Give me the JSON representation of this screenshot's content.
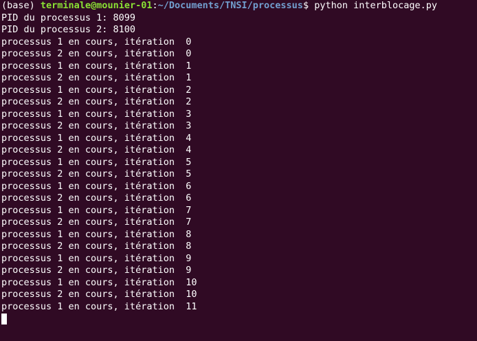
{
  "prompt": {
    "env": "(base) ",
    "user_host": "terminale@mounier-01",
    "separator": ":",
    "path": "~/Documents/TNSI/processus",
    "symbol": "$ ",
    "command": "python interblocage.py"
  },
  "output_lines": [
    "PID du processus 1: 8099",
    "PID du processus 2: 8100",
    "processus 1 en cours, itération  0",
    "processus 2 en cours, itération  0",
    "processus 1 en cours, itération  1",
    "processus 2 en cours, itération  1",
    "processus 1 en cours, itération  2",
    "processus 2 en cours, itération  2",
    "processus 1 en cours, itération  3",
    "processus 2 en cours, itération  3",
    "processus 1 en cours, itération  4",
    "processus 2 en cours, itération  4",
    "processus 1 en cours, itération  5",
    "processus 2 en cours, itération  5",
    "processus 1 en cours, itération  6",
    "processus 2 en cours, itération  6",
    "processus 1 en cours, itération  7",
    "processus 2 en cours, itération  7",
    "processus 1 en cours, itération  8",
    "processus 2 en cours, itération  8",
    "processus 1 en cours, itération  9",
    "processus 2 en cours, itération  9",
    "processus 1 en cours, itération  10",
    "processus 2 en cours, itération  10",
    "processus 1 en cours, itération  11"
  ],
  "colors": {
    "background": "#300a24",
    "text": "#ffffff",
    "user_host": "#8ae234",
    "path": "#729fcf"
  }
}
